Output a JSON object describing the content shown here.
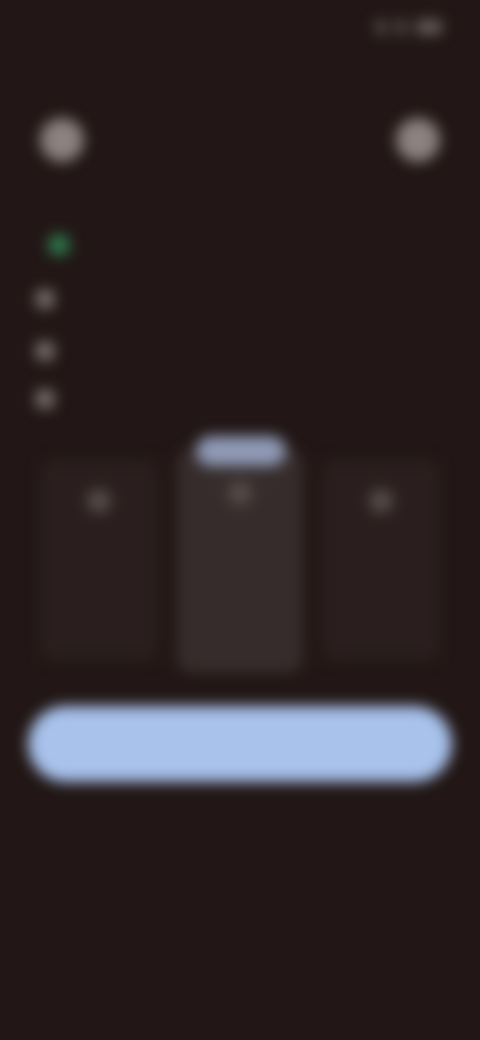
{
  "status_bar": {
    "time": "",
    "icons": [
      "signal-icon",
      "wifi-icon",
      "battery-icon"
    ]
  },
  "header": {
    "left_icon": "close-icon",
    "right_icon": "restore-icon"
  },
  "headline": "",
  "subline": "",
  "features": [
    {
      "icon": "check-icon",
      "label": ""
    },
    {
      "icon": "check-icon",
      "label": ""
    },
    {
      "icon": "check-icon",
      "label": ""
    }
  ],
  "plans": [
    {
      "icon": "plan-icon",
      "name": "",
      "price": "",
      "period": ""
    },
    {
      "icon": "plan-icon",
      "name": "",
      "price": "",
      "period": "",
      "badge": ""
    },
    {
      "icon": "plan-icon",
      "name": "",
      "price": "",
      "period": ""
    }
  ],
  "cta": {
    "label": "",
    "note": ""
  },
  "footer": {
    "links": [
      "",
      "",
      ""
    ]
  },
  "colors": {
    "background": "#221716",
    "accent": "#a8c2ec",
    "badge": "#8f9ab6",
    "success": "#2e7a4e"
  }
}
